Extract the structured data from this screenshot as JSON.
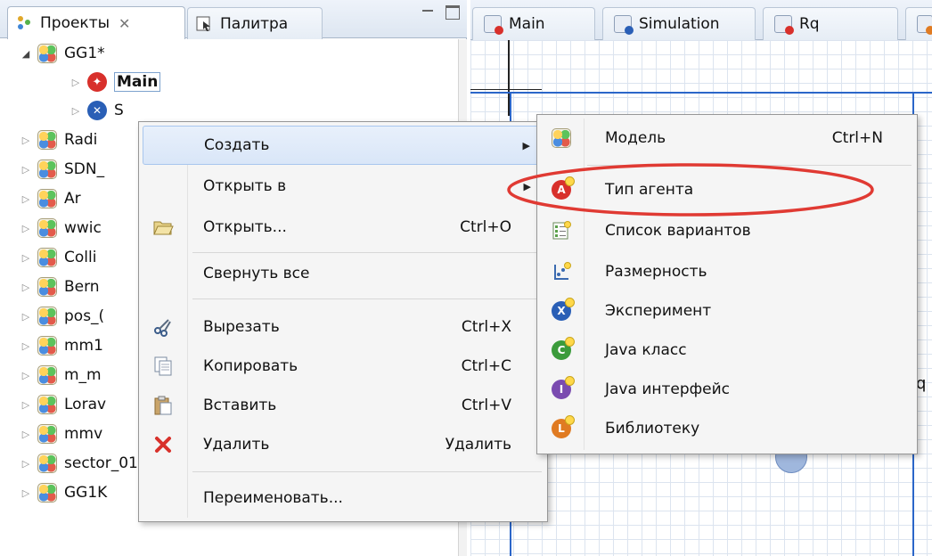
{
  "left_panel": {
    "tabs": [
      {
        "label": "Проекты",
        "close": "✕"
      },
      {
        "label": "Палитра"
      }
    ],
    "tree": [
      {
        "label": "GG1*",
        "expanded": true
      },
      {
        "label": "Main"
      },
      {
        "label": "S"
      },
      {
        "label": "Radi"
      },
      {
        "label": "SDN_"
      },
      {
        "label": "Ar"
      },
      {
        "label": "wwic"
      },
      {
        "label": "Colli"
      },
      {
        "label": "Bern"
      },
      {
        "label": "pos_("
      },
      {
        "label": "mm1"
      },
      {
        "label": "m_m"
      },
      {
        "label": "Lorav"
      },
      {
        "label": "mmv"
      },
      {
        "label": "sector_01"
      },
      {
        "label": "GG1K"
      }
    ]
  },
  "editor": {
    "tabs": [
      {
        "label": "Main",
        "dot": "#d8302b"
      },
      {
        "label": "Simulation",
        "dot": "#2a5fb6"
      },
      {
        "label": "Rq",
        "dot": "#d8302b"
      },
      {
        "label": "",
        "dot": "#e07b22"
      }
    ],
    "canvas_text": "q"
  },
  "context_menu": {
    "items": [
      {
        "label": "Создать",
        "shortcut": "",
        "submenu": true
      },
      {
        "label": "Открыть в",
        "shortcut": "",
        "submenu": true
      },
      {
        "label": "Открыть...",
        "shortcut": "Ctrl+O"
      },
      {
        "label": "Свернуть все",
        "shortcut": ""
      },
      {
        "label": "Вырезать",
        "shortcut": "Ctrl+X"
      },
      {
        "label": "Копировать",
        "shortcut": "Ctrl+C"
      },
      {
        "label": "Вставить",
        "shortcut": "Ctrl+V"
      },
      {
        "label": "Удалить",
        "shortcut": "Удалить"
      },
      {
        "label": "Переименовать...",
        "shortcut": ""
      }
    ]
  },
  "submenu": {
    "items": [
      {
        "label": "Модель",
        "shortcut": "Ctrl+N"
      },
      {
        "label": "Тип агента",
        "shortcut": ""
      },
      {
        "label": "Список вариантов",
        "shortcut": ""
      },
      {
        "label": "Размерность",
        "shortcut": ""
      },
      {
        "label": "Эксперимент",
        "shortcut": ""
      },
      {
        "label": "Java класс",
        "shortcut": ""
      },
      {
        "label": "Java интерфейс",
        "shortcut": ""
      },
      {
        "label": "Библиотеку",
        "shortcut": ""
      }
    ]
  },
  "colors": {
    "annotation": "#e03a33",
    "frame": "#2b66c9",
    "highlight": "#d9e6f8"
  }
}
